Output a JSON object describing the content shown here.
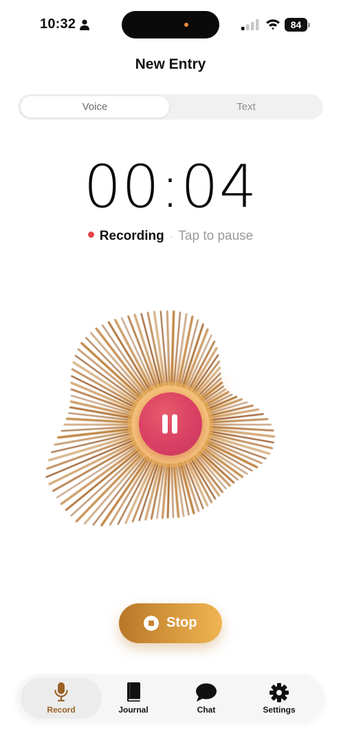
{
  "status_bar": {
    "time": "10:32",
    "battery": "84"
  },
  "header": {
    "title": "New Entry"
  },
  "mode_tabs": [
    {
      "label": "Voice",
      "selected": true
    },
    {
      "label": "Text",
      "selected": false
    }
  ],
  "recorder": {
    "timer": "00:04",
    "state_label": "Recording",
    "separator": "·",
    "hint": "Tap to pause",
    "stop_label": "Stop"
  },
  "tab_bar": {
    "items": [
      {
        "label": "Record",
        "icon": "microphone-icon",
        "active": true
      },
      {
        "label": "Journal",
        "icon": "book-icon",
        "active": false
      },
      {
        "label": "Chat",
        "icon": "chat-bubble-icon",
        "active": false
      },
      {
        "label": "Settings",
        "icon": "gear-icon",
        "active": false
      }
    ]
  },
  "colors": {
    "accent": "#c48433",
    "recording_dot": "#e04545",
    "pause_button": "#d94063"
  }
}
